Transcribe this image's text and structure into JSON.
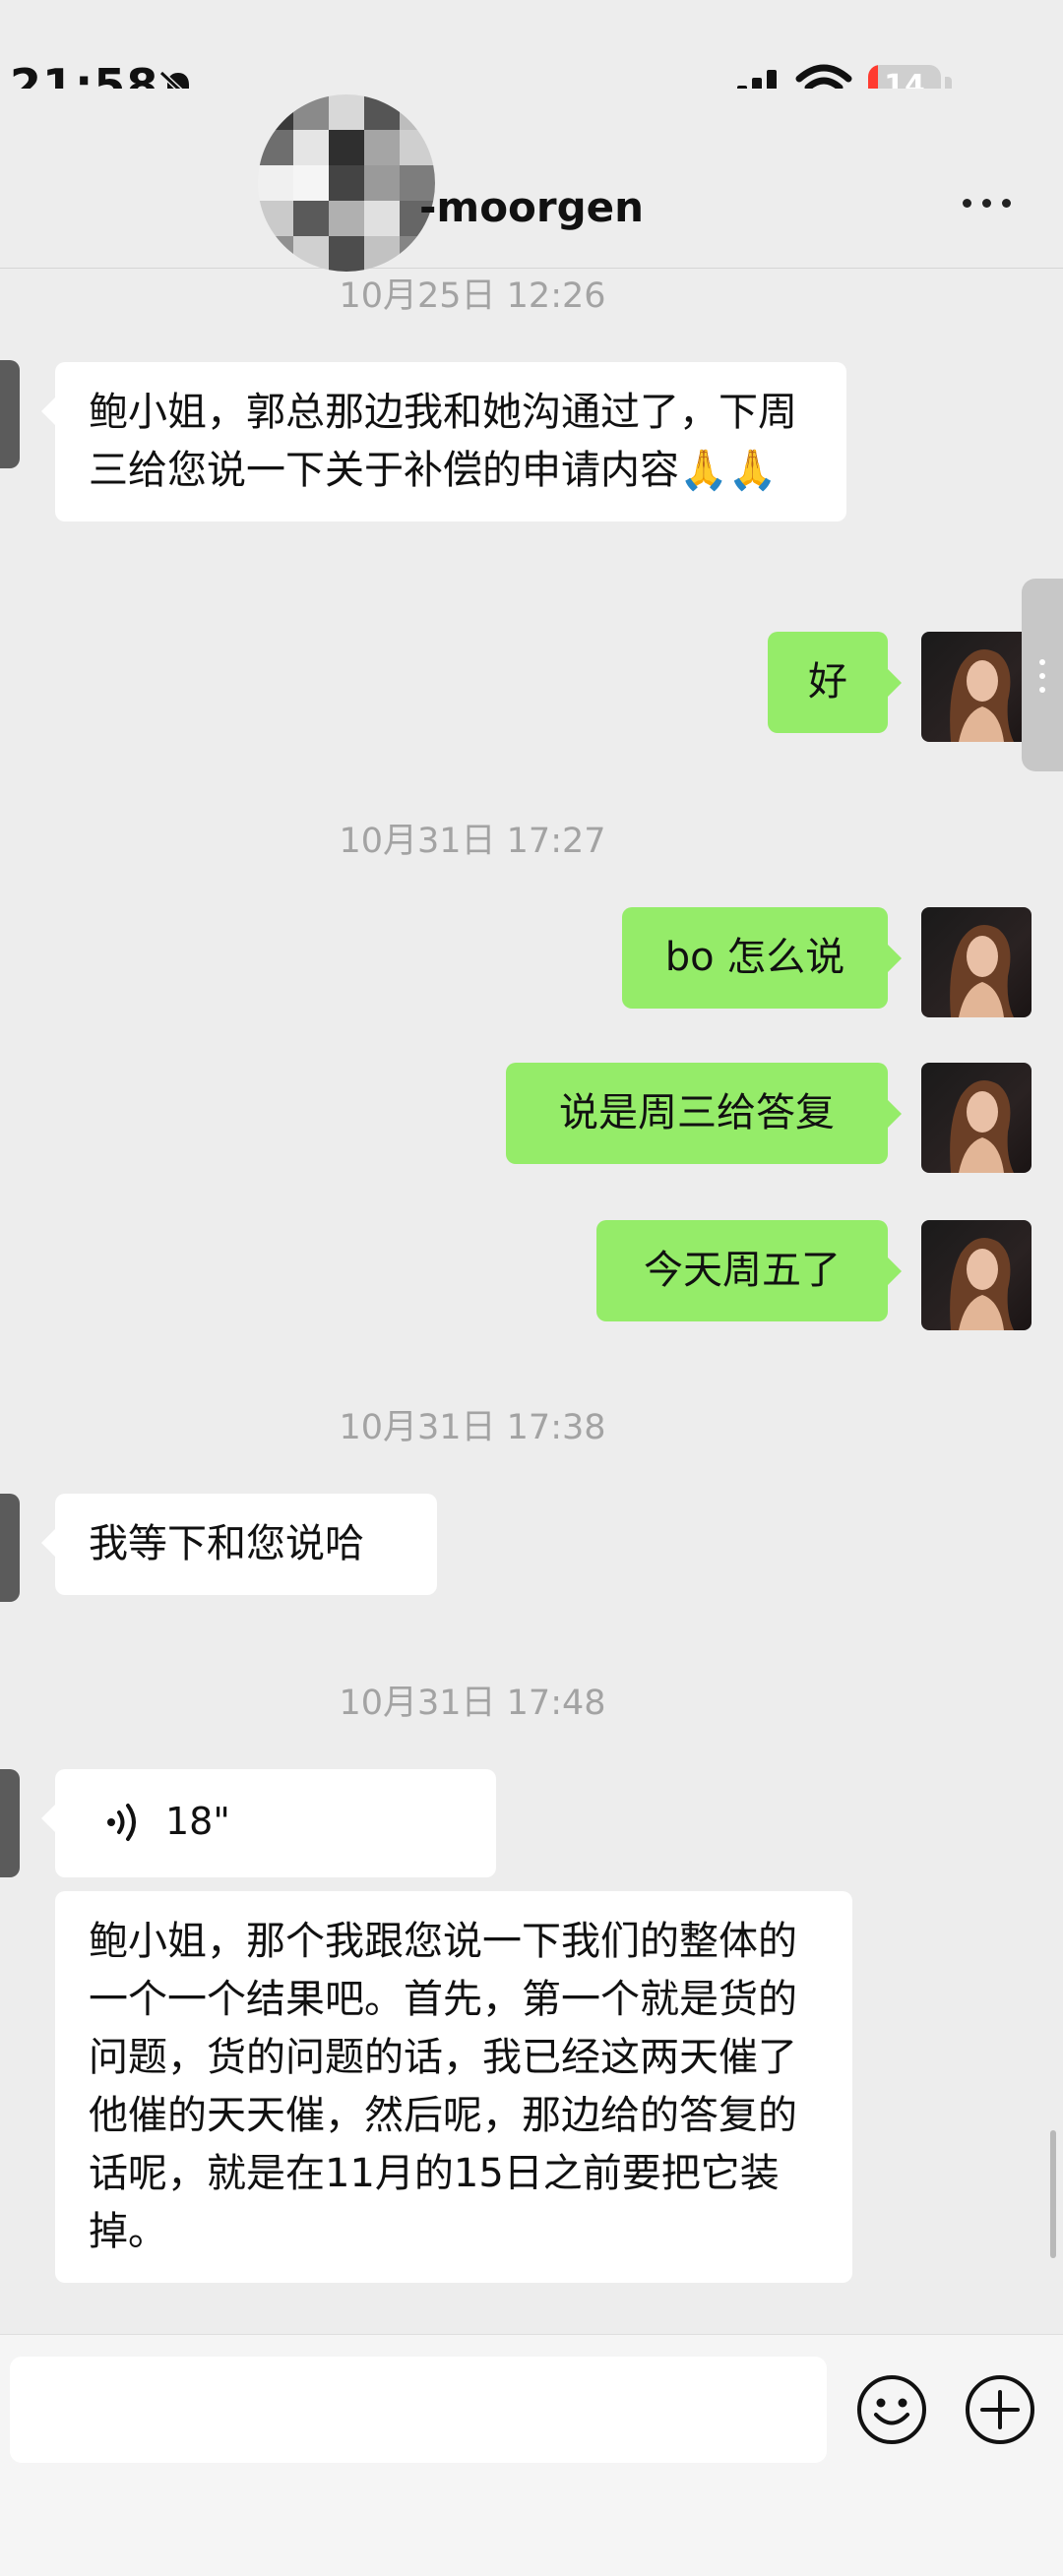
{
  "status_bar": {
    "time": "21:58",
    "battery_level": "14",
    "battery_fraction": 0.14,
    "icons": [
      "bell-muted-icon",
      "signal-icon",
      "wifi-icon",
      "battery-icon"
    ]
  },
  "header": {
    "title": "-moorgen",
    "more_icon": "more-dots-icon"
  },
  "timestamps": {
    "t1": "10月25日 12:26",
    "t2": "10月31日 17:27",
    "t3": "10月31日 17:38",
    "t4": "10月31日 17:48"
  },
  "messages": {
    "m1": "鲍小姐，郭总那边我和她沟通过了，下周三给您说一下关于补偿的申请内容🙏🙏",
    "m2": "好",
    "m3": "bo 怎么说",
    "m4": "说是周三给答复",
    "m5": "今天周五了",
    "m6": "我等下和您说哈",
    "m7_voice_length": "18\"",
    "m8": "鲍小姐，那个我跟您说一下我们的整体的一个一个结果吧。首先，第一个就是货的问题，货的问题的话，我已经这两天催了他催的天天催，然后呢，那边给的答复的话呢，就是在11月的15日之前要把它装掉。"
  },
  "input_bar": {
    "emoji_icon": "emoji-icon",
    "plus_icon": "plus-icon"
  },
  "colors": {
    "background": "#ededed",
    "sent_bubble": "#95ec69",
    "received_bubble": "#ffffff",
    "timestamp": "#a3a3a3"
  }
}
